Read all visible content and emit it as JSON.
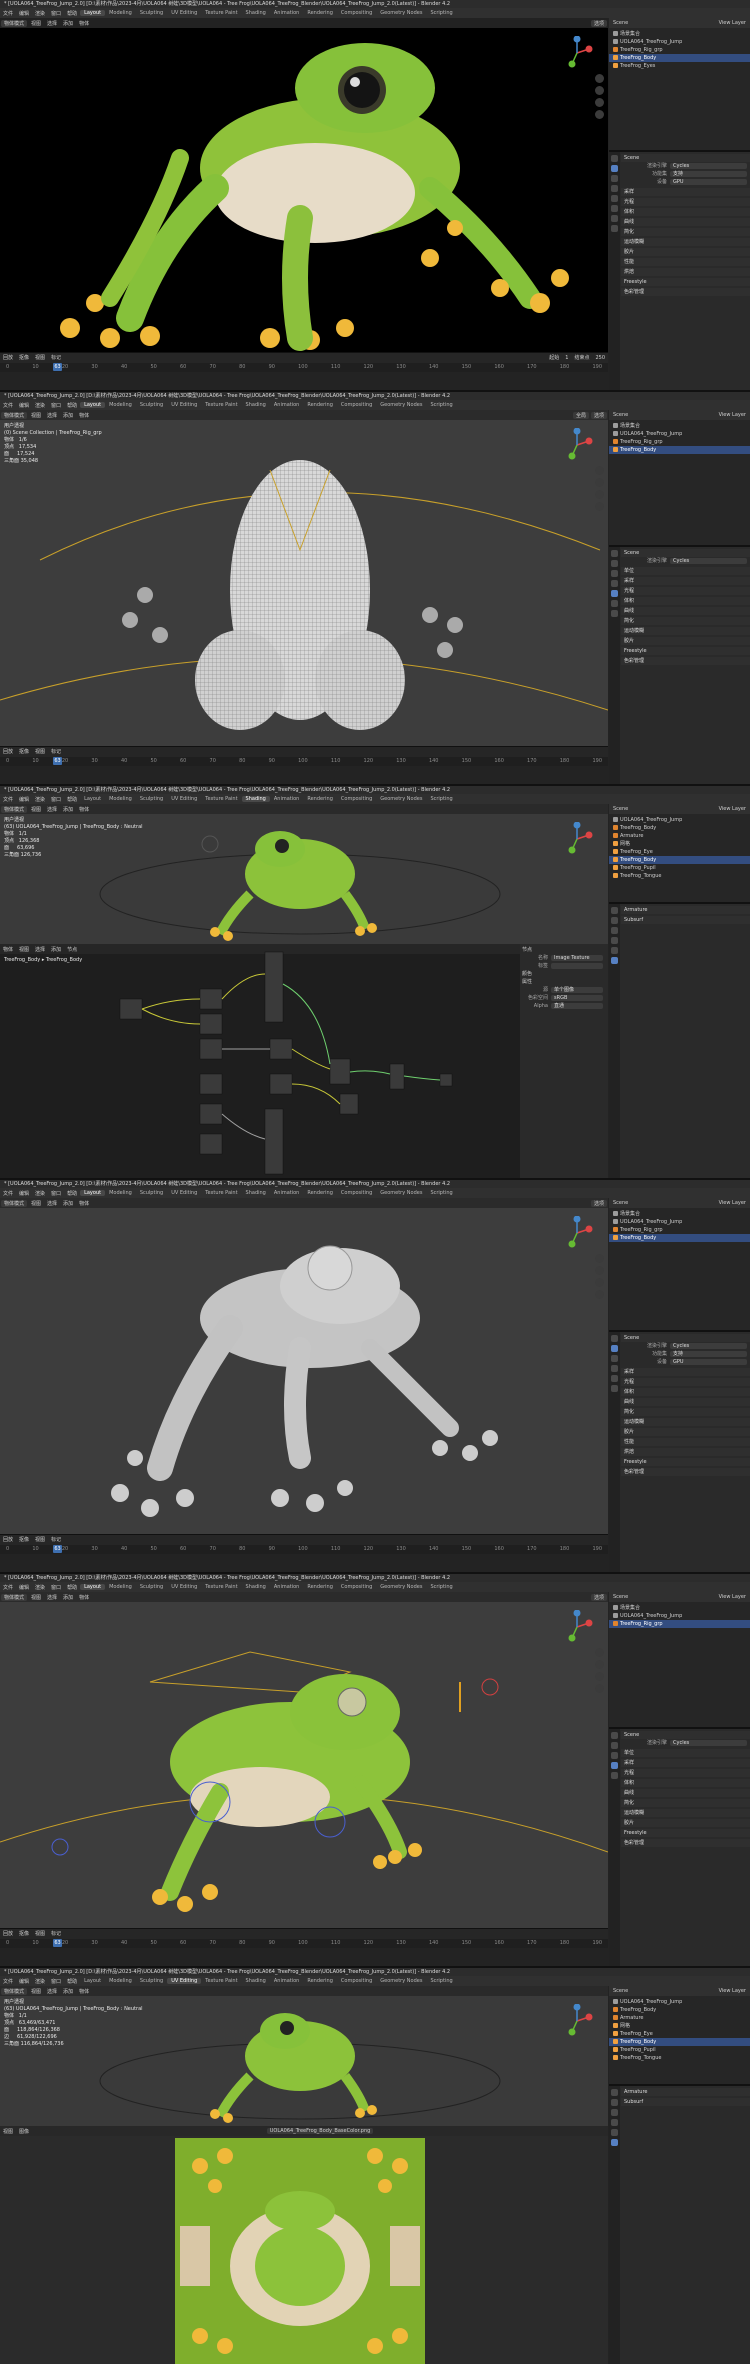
{
  "title": "* [UOLA064_TreeFrog_Jump_2.0] [D:\\素材\\作品\\2023-4月\\UOLA064 树蛙\\3D模型\\UOLA064 - Tree Frog\\UOLA064_TreeFrog_Blender\\UOLA064_TreeFrog_Jump_2.0(Latest)] - Blender 4.2",
  "menu": [
    "文件",
    "编辑",
    "渲染",
    "窗口",
    "帮助"
  ],
  "workspaces": [
    "Layout",
    "Modeling",
    "Sculpting",
    "UV Editing",
    "Texture Paint",
    "Shading",
    "Animation",
    "Rendering",
    "Compositing",
    "Geometry Nodes",
    "Scripting"
  ],
  "viewport_header": [
    "物体模式",
    "视图",
    "选择",
    "添加",
    "物体"
  ],
  "global_label": "全局",
  "options_label": "选项",
  "viewport_info": [
    "",
    "用户透视\n(0) Scene Collection | TreeFrog_Rig_grp\n物体   1/6\n顶点   17,534\n面     17,524\n三角面 35,048",
    "用户透视\n(63) UOLA064_TreeFrog_Jump | TreeFrog_Body : Neutral\n物体   1/1\n顶点   126,368\n面     63,696\n三角面 126,736",
    "",
    "",
    "用户透视\n(63) UOLA064_TreeFrog_Jump | TreeFrog_Body : Neutral\n物体   1/1\n顶点   63,469/63,471\n面     118,864/126,368\n边     61,928/122,696\n三角面 116,864/126,736"
  ],
  "timeline": {
    "labels": [
      "回放",
      "抠像",
      "视图",
      "标记"
    ],
    "ruler": [
      "0",
      "10",
      "20",
      "30",
      "40",
      "50",
      "60",
      "70",
      "80",
      "90",
      "100",
      "110",
      "120",
      "130",
      "140",
      "150",
      "160",
      "170",
      "180",
      "190"
    ],
    "current_frame": "63",
    "start_label": "起始",
    "start": "1",
    "end_label": "结束点",
    "end": "250"
  },
  "outliner": {
    "scene_label": "Scene",
    "view_layer_label": "View Layer",
    "sets": [
      [
        {
          "label": "场景集合",
          "icon": "c"
        },
        {
          "label": "UOLA064_TreeFrog_Jump",
          "icon": "c"
        },
        {
          "label": "TreeFrog_Rig_grp",
          "icon": "o"
        },
        {
          "label": "TreeFrog_Body",
          "icon": "m"
        },
        {
          "label": "TreeFrog_Eyes",
          "icon": "m"
        }
      ],
      [
        {
          "label": "场景集合",
          "icon": "c"
        },
        {
          "label": "UOLA064_TreeFrog_Jump",
          "icon": "c"
        },
        {
          "label": "TreeFrog_Rig_grp",
          "icon": "o"
        },
        {
          "label": "TreeFrog_Body",
          "icon": "m"
        }
      ],
      [
        {
          "label": "UOLA064_TreeFrog_Jump",
          "icon": "c"
        },
        {
          "label": "TreeFrog_Body",
          "icon": "o"
        },
        {
          "label": "Armature",
          "icon": "o"
        },
        {
          "label": "网格",
          "icon": "m"
        },
        {
          "label": "TreeFrog_Eye",
          "icon": "m"
        },
        {
          "label": "TreeFrog_Body",
          "icon": "m"
        },
        {
          "label": "TreeFrog_Pupil",
          "icon": "m"
        },
        {
          "label": "TreeFrog_Tongue",
          "icon": "m"
        }
      ],
      [
        {
          "label": "场景集合",
          "icon": "c"
        },
        {
          "label": "UOLA064_TreeFrog_Jump",
          "icon": "c"
        },
        {
          "label": "TreeFrog_Rig_grp",
          "icon": "o"
        },
        {
          "label": "TreeFrog_Body",
          "icon": "m"
        }
      ],
      [
        {
          "label": "场景集合",
          "icon": "c"
        },
        {
          "label": "UOLA064_TreeFrog_Jump",
          "icon": "c"
        },
        {
          "label": "TreeFrog_Rig_grp",
          "icon": "o"
        }
      ],
      [
        {
          "label": "UOLA064_TreeFrog_Jump",
          "icon": "c"
        },
        {
          "label": "TreeFrog_Body",
          "icon": "o"
        },
        {
          "label": "Armature",
          "icon": "o"
        },
        {
          "label": "网格",
          "icon": "m"
        },
        {
          "label": "TreeFrog_Eye",
          "icon": "m"
        },
        {
          "label": "TreeFrog_Body",
          "icon": "m"
        },
        {
          "label": "TreeFrog_Pupil",
          "icon": "m"
        },
        {
          "label": "TreeFrog_Tongue",
          "icon": "m"
        }
      ]
    ],
    "selected_index": [
      3,
      3,
      5,
      3,
      2,
      5
    ]
  },
  "properties": {
    "section_scene": "Scene",
    "section_units": "单位",
    "rows": [
      {
        "k": "渲染引擎",
        "v": "Cycles"
      },
      {
        "k": "功能集",
        "v": "支持"
      },
      {
        "k": "设备",
        "v": "GPU"
      }
    ],
    "sections": [
      "采样",
      "光程",
      "体积",
      "曲线",
      "简化",
      "运动模糊",
      "胶片",
      "性能",
      "烘焙",
      "Freestyle",
      "色彩管理"
    ],
    "mod_rows": [
      "Armature",
      "Subsurf"
    ]
  },
  "node_editor": {
    "header": [
      "物体",
      "视图",
      "选择",
      "添加",
      "节点"
    ],
    "breadcrumb": "TreeFrog_Body ▸ TreeFrog_Body",
    "side_labels": [
      "节点",
      "名称",
      "标签",
      "颜色",
      "属性",
      "Image Texture",
      "源",
      "单个图像",
      "色彩空间",
      "sRGB",
      "Alpha",
      "直通"
    ]
  },
  "image_editor": {
    "header": [
      "视图",
      "图像"
    ],
    "image_name": "UOLA064_TreeFrog_Body_BaseColor.png"
  }
}
